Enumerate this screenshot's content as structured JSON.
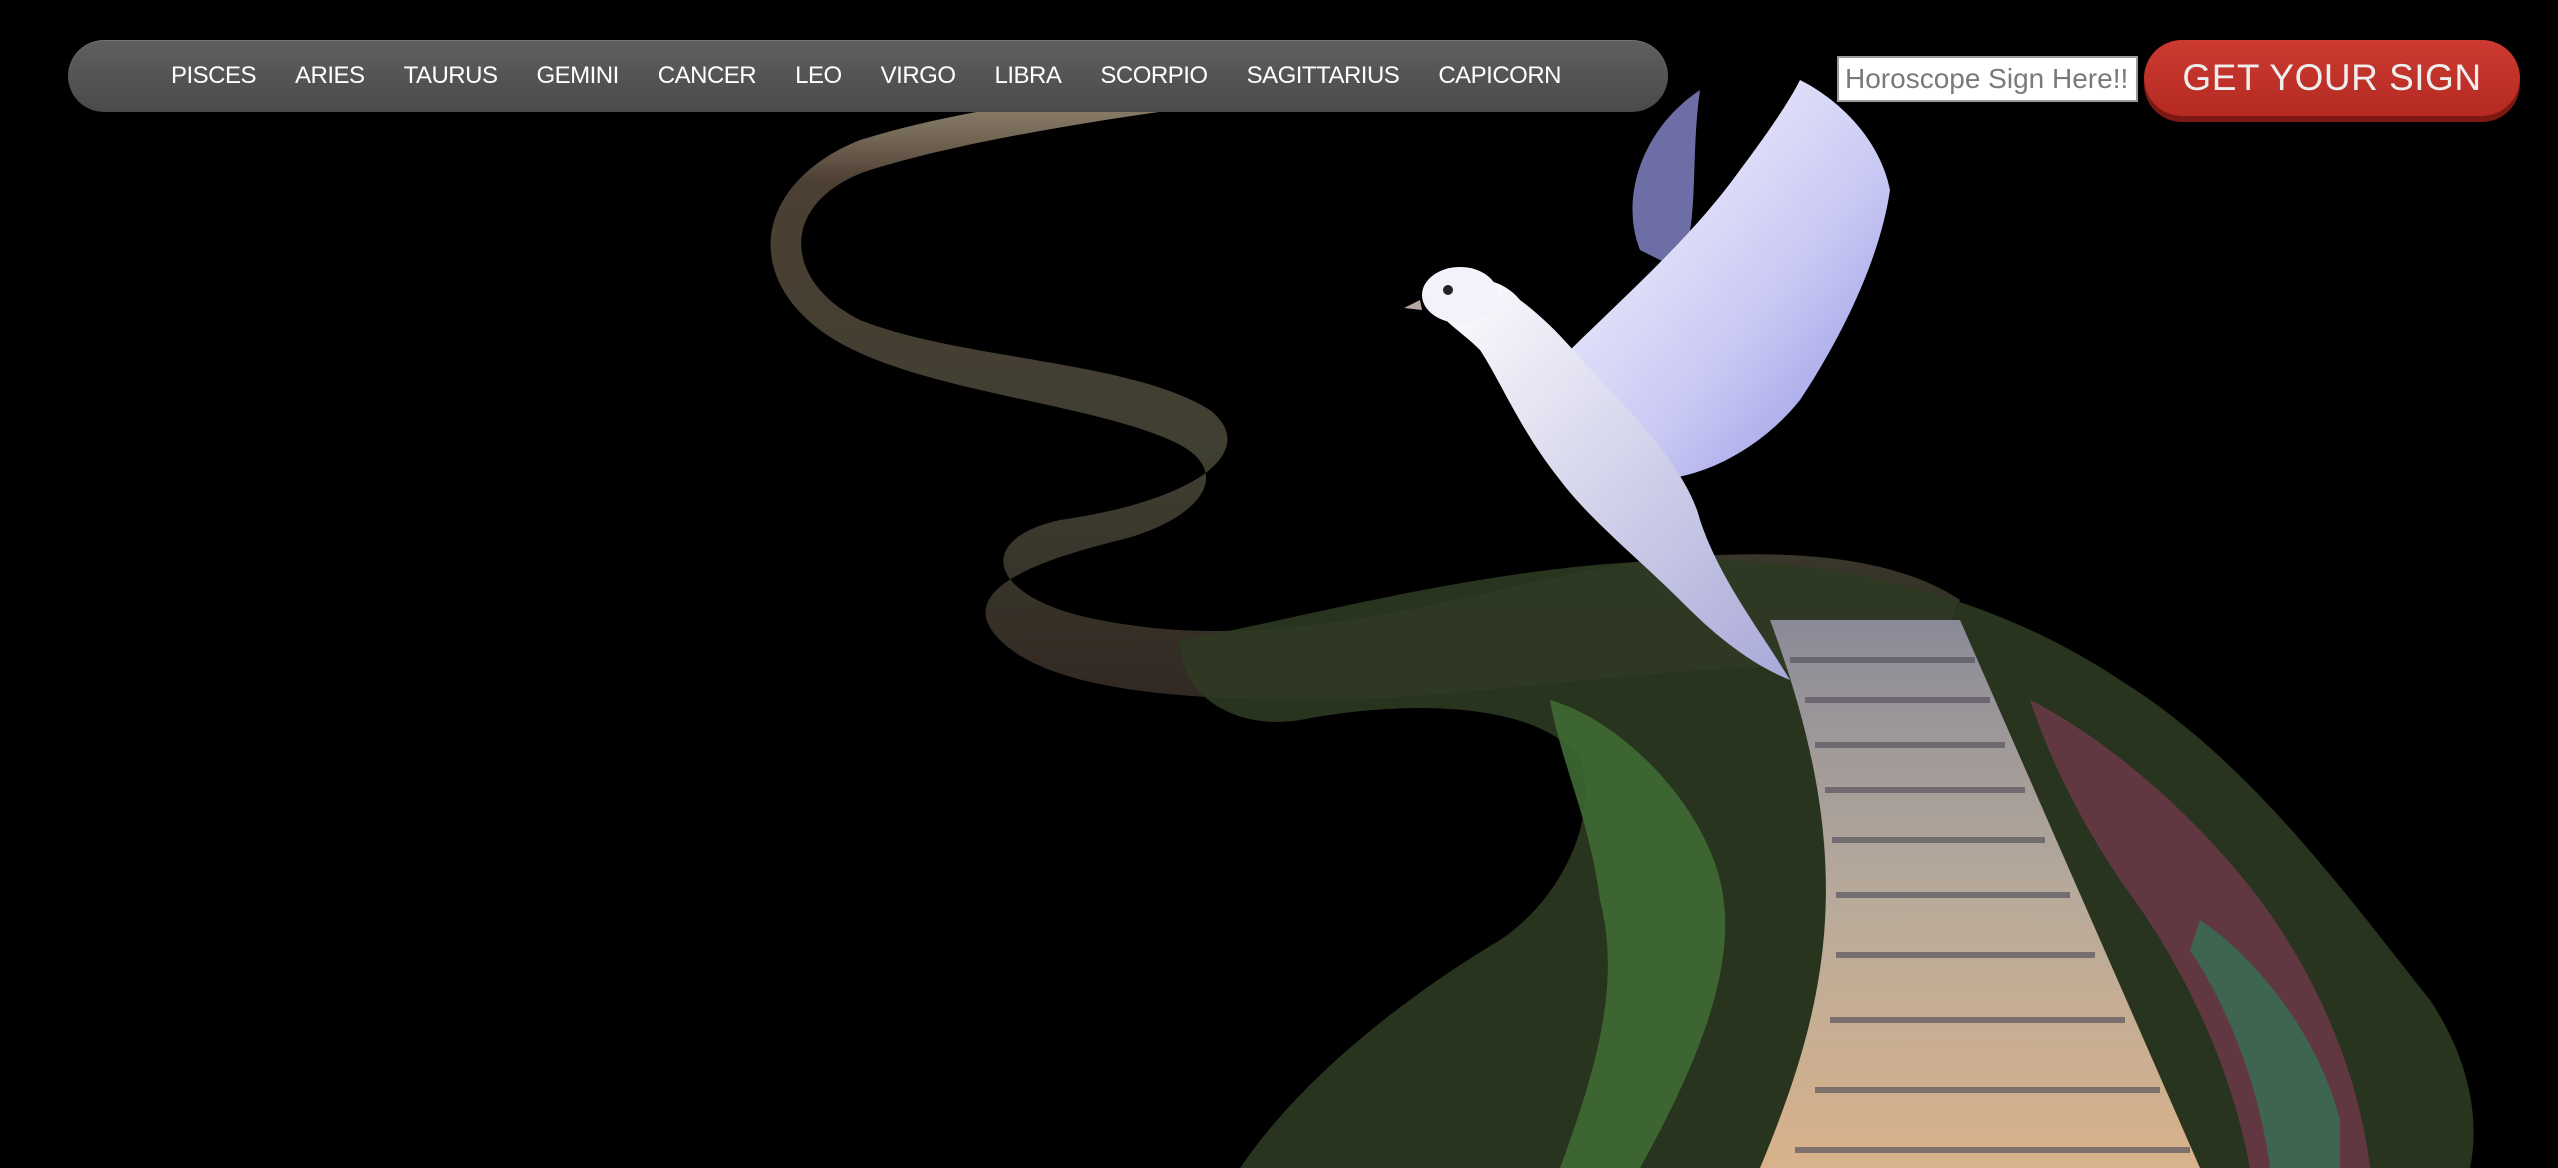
{
  "nav": {
    "items": [
      {
        "label": "PISCES"
      },
      {
        "label": "ARIES"
      },
      {
        "label": "TAURUS"
      },
      {
        "label": "GEMINI"
      },
      {
        "label": "CANCER"
      },
      {
        "label": "LEO"
      },
      {
        "label": "VIRGO"
      },
      {
        "label": "LIBRA"
      },
      {
        "label": "SCORPIO"
      },
      {
        "label": "SAGITTARIUS"
      },
      {
        "label": "CAPICORN"
      }
    ]
  },
  "search": {
    "placeholder": "Horoscope Sign Here!!",
    "value": ""
  },
  "cta": {
    "label": "GET YOUR SIGN"
  },
  "colors": {
    "background": "#000000",
    "navbar": "#555555",
    "button": "#c0332b",
    "button_text": "#eeeeee"
  },
  "hero": {
    "image_description_icon": "stairway-dove-image"
  }
}
